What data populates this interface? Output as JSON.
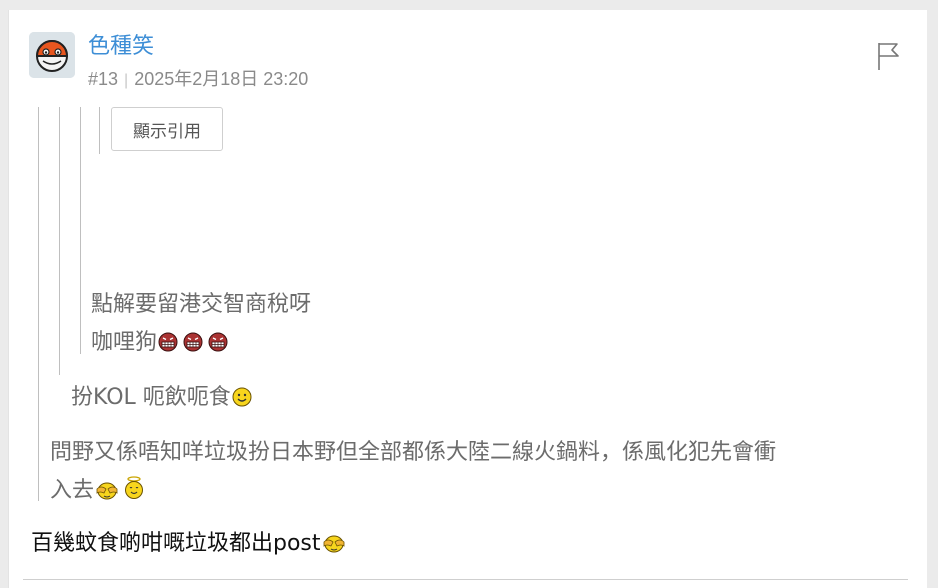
{
  "post": {
    "username": "色種笑",
    "post_number": "#13",
    "timestamp": "2025年2月18日 23:20"
  },
  "quote": {
    "show_quote_label": "顯示引用",
    "level3_line1": "點解要留港交智商稅呀",
    "level3_line2": "咖哩狗",
    "level2_text": "扮KOL 呃飲呃食",
    "level1_line1": "問野又係唔知咩垃圾扮日本野但全部都係大陸二線火鍋料，係風化犯先會衝",
    "level1_line2": "入去"
  },
  "reply": {
    "text": "百幾蚊食啲咁嘅垃圾都出post"
  },
  "icons": [
    "avatar-pokeball",
    "flag-icon",
    "angry-face-emoji",
    "smile-emoji",
    "cover-eyes-emoji",
    "angel-emoji"
  ],
  "colors": {
    "username": "#3d8ed6",
    "meta": "#8a8a8a",
    "quote_text": "#6c6c6c",
    "body_text": "#111111"
  }
}
